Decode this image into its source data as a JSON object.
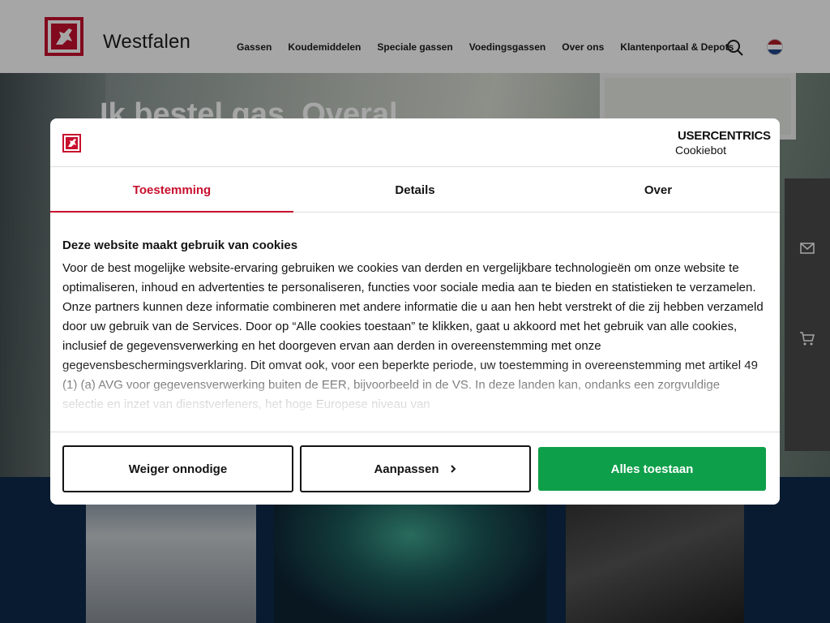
{
  "header": {
    "brand": "Westfalen",
    "nav": [
      "Gassen",
      "Koudemiddelen",
      "Speciale gassen",
      "Voedingsgassen",
      "Over ons",
      "Klantenportaal & Depots"
    ]
  },
  "hero": {
    "title": "Ik bestel gas. Overal."
  },
  "dialog": {
    "provider_name": "USERCENTRICS",
    "provider_sub": "Cookiebot",
    "tabs": [
      {
        "label": "Toestemming",
        "active": true
      },
      {
        "label": "Details",
        "active": false
      },
      {
        "label": "Over",
        "active": false
      }
    ],
    "content_title": "Deze website maakt gebruik van cookies",
    "content_text": "Voor de best mogelijke website-ervaring gebruiken we cookies van derden en vergelijkbare technologieën om onze website te optimaliseren, inhoud en advertenties te personaliseren, functies voor sociale media aan te bieden en statistieken te verzamelen. Onze partners kunnen deze informatie combineren met andere informatie die u aan hen hebt verstrekt of die zij hebben verzameld door uw gebruik van de Services. Door op “Alle cookies toestaan” te klikken, gaat u akkoord met het gebruik van alle cookies, inclusief de gegevensverwerking en het doorgeven ervan aan derden in overeenstemming met onze gegevensbeschermingsverklaring. Dit omvat ook, voor een beperkte periode, uw toestemming in overeenstemming met artikel 49 (1) (a) AVG voor gegevensverwerking buiten de EER, bijvoorbeeld in de VS. In deze landen kan, ondanks een zorgvuldige selectie en inzet van dienstverleners, het hoge Europese niveau van",
    "buttons": {
      "deny": "Weiger onnodige",
      "customize": "Aanpassen",
      "accept": "Alles toestaan"
    }
  },
  "colors": {
    "brand_red": "#c8102e",
    "accept_green": "#0e9f4a",
    "dark_navy": "#0d2a4a"
  },
  "icons": {
    "search": "search-icon",
    "flag": "netherlands-flag-icon",
    "mail": "mail-icon",
    "cart": "cart-icon",
    "chevron": "chevron-right-icon"
  }
}
